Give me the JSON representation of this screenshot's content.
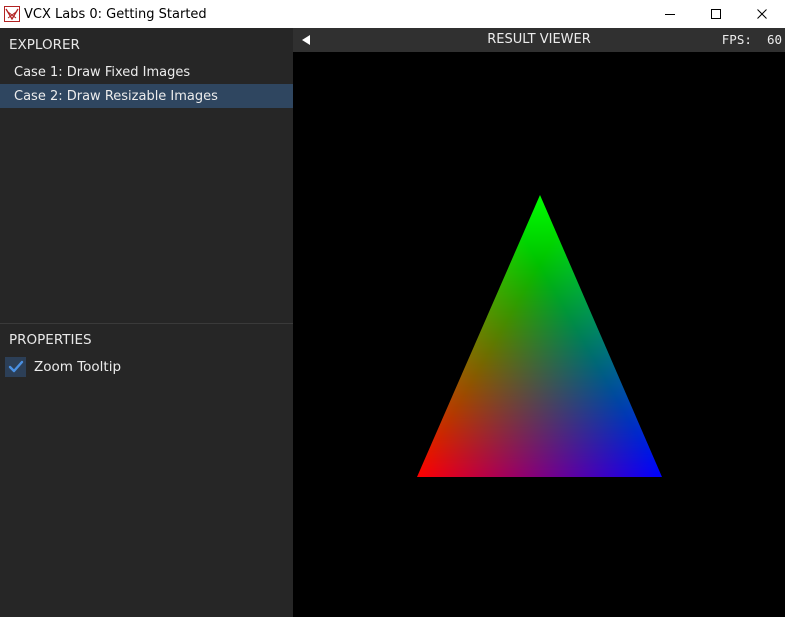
{
  "window": {
    "title": "VCX Labs 0: Getting Started",
    "icon": "vcx-app-icon",
    "controls": [
      "minimize-icon",
      "maximize-icon",
      "close-icon"
    ]
  },
  "explorer": {
    "title": "EXPLORER",
    "items": [
      {
        "label": "Case 1: Draw Fixed Images",
        "selected": false
      },
      {
        "label": "Case 2: Draw Resizable Images",
        "selected": true
      }
    ]
  },
  "properties": {
    "title": "PROPERTIES",
    "zoom_tooltip": {
      "label": "Zoom Tooltip",
      "checked": true
    }
  },
  "viewer": {
    "title": "RESULT VIEWER",
    "fps_label": "FPS:",
    "fps_value": "60",
    "collapse_icon": "triangle-left-icon"
  },
  "scene": {
    "shape": "triangle",
    "vertex_colors": {
      "top": "#00ff00",
      "bottom_left": "#ff0000",
      "bottom_right": "#0000ff"
    }
  },
  "colors": {
    "panel_bg": "#262626",
    "selected_bg": "#2f4660",
    "checkbox_bg": "#2c3f57",
    "check_mark": "#4a90e2"
  }
}
